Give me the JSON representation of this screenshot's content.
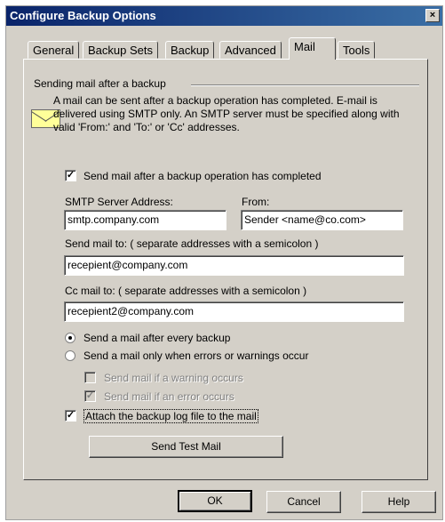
{
  "window": {
    "title": "Configure Backup Options",
    "close_glyph": "×"
  },
  "tabs": [
    {
      "label": "General"
    },
    {
      "label": "Backup Sets"
    },
    {
      "label": "Backup"
    },
    {
      "label": "Advanced"
    },
    {
      "label": "Mail"
    },
    {
      "label": "Tools"
    }
  ],
  "active_tab": "Mail",
  "section": {
    "title": "Sending mail after a backup",
    "icon": "envelope-icon",
    "info": "A mail can be sent after a backup operation has completed. E-mail is delivered using SMTP only.  An SMTP server must be specified along with valid 'From:' and 'To:' or 'Cc' addresses."
  },
  "send_mail": {
    "label": "Send mail after a backup operation has completed",
    "checked": true
  },
  "smtp": {
    "label": "SMTP Server Address:",
    "value": "smtp.company.com"
  },
  "from": {
    "label": "From:",
    "value": "Sender <name@co.com>"
  },
  "send_to": {
    "label": "Send mail to:  ( separate addresses with a semicolon )",
    "value": "recepient@company.com"
  },
  "cc": {
    "label": "Cc mail to:  ( separate addresses with a semicolon )",
    "value": "recepient2@company.com"
  },
  "schedule": {
    "every_label": "Send a mail after every backup",
    "errors_label": "Send a mail only when errors or warnings occur",
    "selected": "every"
  },
  "sub_options": {
    "warning_label": "Send mail if a warning occurs",
    "warning_checked": false,
    "error_label": "Send mail if an error occurs",
    "error_checked": true,
    "enabled": false
  },
  "attach_log": {
    "label": "Attach the backup log file to the mail",
    "checked": true
  },
  "buttons": {
    "test": "Send Test Mail",
    "ok": "OK",
    "cancel": "Cancel",
    "help": "Help"
  },
  "colors": {
    "dialog_bg": "#d4d0c8",
    "title_bar": "#0a246a",
    "envelope": "#ffff99"
  }
}
